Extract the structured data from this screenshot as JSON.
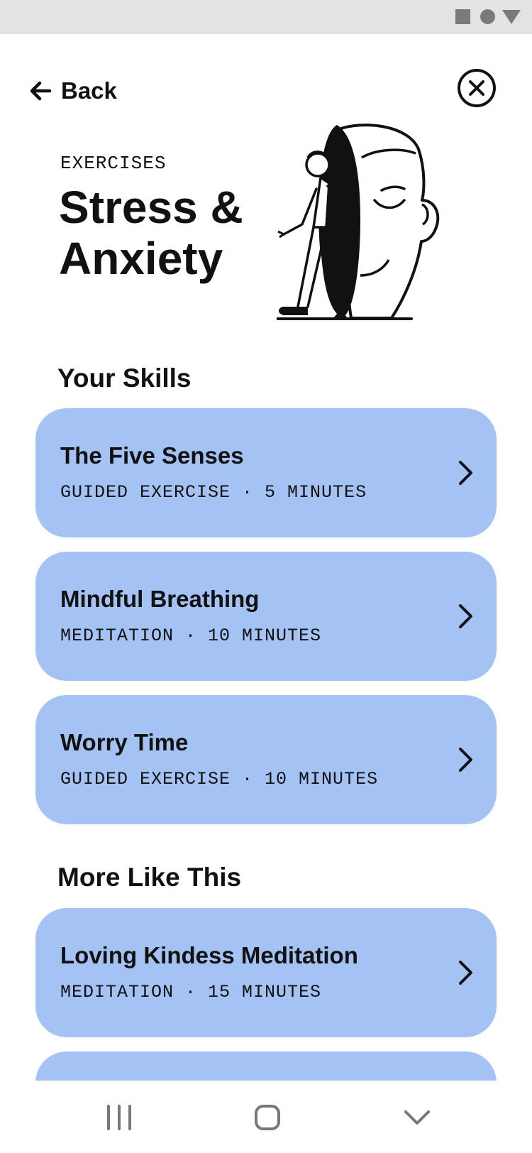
{
  "header": {
    "back_label": "Back",
    "eyebrow": "EXERCISES",
    "title": "Stress & Anxiety"
  },
  "sections": {
    "skills_title": "Your Skills",
    "more_title": "More Like This"
  },
  "skills": [
    {
      "name": "The Five Senses",
      "meta": "GUIDED EXERCISE · 5 MINUTES"
    },
    {
      "name": "Mindful Breathing",
      "meta": "MEDITATION · 10 MINUTES"
    },
    {
      "name": "Worry Time",
      "meta": "GUIDED EXERCISE · 10 MINUTES"
    }
  ],
  "more": [
    {
      "name": "Loving Kindess Meditation",
      "meta": "MEDITATION · 15 MINUTES"
    }
  ],
  "icons": {
    "back": "arrow-left-icon",
    "close": "close-circle-icon",
    "chevron": "chevron-right-icon",
    "nav": [
      "recent-apps-icon",
      "home-icon",
      "back-chevron-icon"
    ]
  },
  "colors": {
    "card_bg": "#a4c2f4",
    "status_bar": "#e3e3e3",
    "text": "#111111"
  }
}
